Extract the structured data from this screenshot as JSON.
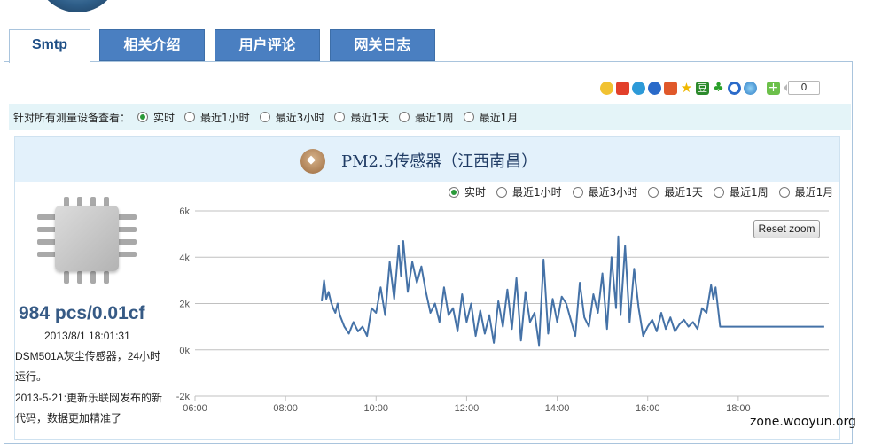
{
  "tabs": [
    {
      "label": "Smtp",
      "active": true
    },
    {
      "label": "相关介绍",
      "active": false
    },
    {
      "label": "用户评论",
      "active": false
    },
    {
      "label": "网关日志",
      "active": false
    }
  ],
  "share": {
    "icons": [
      "qzone-icon",
      "weibo-icon",
      "pengyou-icon",
      "renren-icon",
      "kaixin-icon",
      "star-icon",
      "douban-icon",
      "clover-icon",
      "qq-icon",
      "globe-icon",
      "add-icon"
    ],
    "count": "0"
  },
  "filter": {
    "label": "针对所有测量设备查看：",
    "options": [
      "实时",
      "最近1小时",
      "最近3小时",
      "最近1天",
      "最近1周",
      "最近1月"
    ],
    "selected": "实时"
  },
  "panel": {
    "title": "PM2.5传感器（江西南昌）",
    "reading": "984 pcs/0.01cf",
    "reading_time": "2013/8/1 18:01:31",
    "description": "DSM501A灰尘传感器，24小时运行。",
    "update_note": "2013-5-21:更新乐联网发布的新代码，数据更加精准了"
  },
  "chart_range": {
    "options": [
      "实时",
      "最近1小时",
      "最近3小时",
      "最近1天",
      "最近1周",
      "最近1月"
    ],
    "selected": "实时"
  },
  "reset_zoom": "Reset zoom",
  "watermark": "zone.wooyun.org",
  "colors": {
    "tab_blue": "#4a7fc1",
    "line": "#4572a7",
    "filter_bg": "#e4f4f8"
  },
  "chart_data": {
    "type": "line",
    "title": "",
    "xlabel": "",
    "ylabel": "",
    "x_ticks": [
      "06:00",
      "08:00",
      "10:00",
      "12:00",
      "14:00",
      "16:00",
      "18:00"
    ],
    "y_ticks": [
      "6k",
      "4k",
      "2k",
      "0k",
      "-2k"
    ],
    "xlim": [
      6.0,
      20.0
    ],
    "ylim": [
      -2000,
      6000
    ],
    "grid": true,
    "series": [
      {
        "x": [
          8.8,
          8.85,
          8.9,
          8.95,
          9.0,
          9.05,
          9.1,
          9.15,
          9.2,
          9.3,
          9.4,
          9.5,
          9.6,
          9.7,
          9.8,
          9.9,
          10.0,
          10.1,
          10.2,
          10.3,
          10.4,
          10.5,
          10.55,
          10.6,
          10.7,
          10.8,
          10.9,
          11.0,
          11.1,
          11.2,
          11.3,
          11.4,
          11.5,
          11.6,
          11.7,
          11.8,
          11.9,
          12.0,
          12.1,
          12.2,
          12.3,
          12.4,
          12.5,
          12.6,
          12.7,
          12.8,
          12.9,
          13.0,
          13.1,
          13.2,
          13.3,
          13.4,
          13.5,
          13.6,
          13.7,
          13.8,
          13.9,
          14.0,
          14.1,
          14.2,
          14.3,
          14.4,
          14.5,
          14.6,
          14.7,
          14.8,
          14.9,
          15.0,
          15.1,
          15.2,
          15.3,
          15.35,
          15.4,
          15.5,
          15.6,
          15.7,
          15.8,
          15.9,
          16.0,
          16.1,
          16.2,
          16.3,
          16.4,
          16.5,
          16.6,
          16.7,
          16.8,
          16.9,
          17.0,
          17.1,
          17.2,
          17.3,
          17.4,
          17.45,
          17.5,
          17.6,
          17.7,
          18.0,
          19.0,
          19.9
        ],
        "y": [
          2100,
          3000,
          2200,
          2500,
          2100,
          1800,
          1600,
          2000,
          1500,
          1000,
          700,
          1200,
          800,
          1000,
          600,
          1800,
          1600,
          2700,
          1500,
          3800,
          2200,
          4500,
          3200,
          4700,
          2500,
          3800,
          2900,
          3600,
          2500,
          1600,
          2000,
          1200,
          2700,
          1500,
          1800,
          800,
          2400,
          1200,
          2000,
          600,
          1700,
          700,
          1500,
          300,
          2100,
          1000,
          2600,
          900,
          3100,
          400,
          2500,
          1200,
          1600,
          200,
          3900,
          700,
          2200,
          1200,
          2300,
          2000,
          1300,
          600,
          2900,
          1400,
          1000,
          2400,
          1600,
          3300,
          900,
          4000,
          1800,
          4900,
          1500,
          4500,
          1200,
          3500,
          1800,
          600,
          1000,
          1300,
          800,
          1600,
          900,
          1400,
          800,
          1100,
          1300,
          1000,
          1200,
          900,
          1800,
          1600,
          2800,
          2200,
          2700,
          1000,
          1000,
          1000,
          1000,
          1000
        ]
      }
    ]
  }
}
